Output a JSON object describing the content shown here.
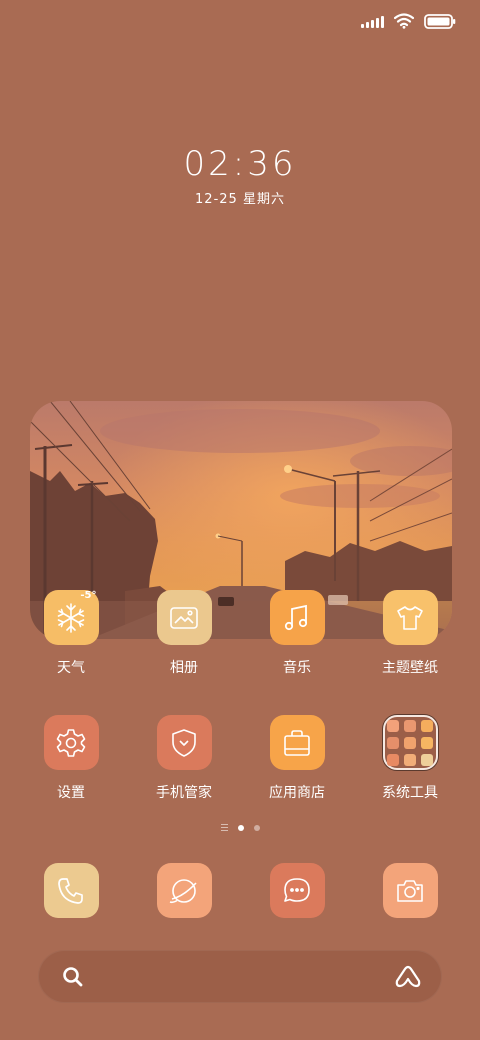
{
  "status_bar": {
    "signal_icon": "signal-bars-icon",
    "wifi_icon": "wifi-icon",
    "battery_icon": "battery-icon"
  },
  "clock": {
    "time": "02:36",
    "date": "12-25 星期六"
  },
  "photo_widget": {
    "icon": "sunset-photo"
  },
  "apps_row1": [
    {
      "label": "天气",
      "icon": "snowflake-icon",
      "badge": "-5°",
      "color": "#f6bd66"
    },
    {
      "label": "相册",
      "icon": "gallery-icon",
      "color": "#ebc88e"
    },
    {
      "label": "音乐",
      "icon": "music-note-icon",
      "color": "#f6a349"
    },
    {
      "label": "主题壁纸",
      "icon": "tshirt-icon",
      "color": "#f8c16b"
    }
  ],
  "apps_row2": [
    {
      "label": "设置",
      "icon": "gear-icon",
      "color": "#db7a5c"
    },
    {
      "label": "手机管家",
      "icon": "shield-icon",
      "color": "#da7a5c"
    },
    {
      "label": "应用商店",
      "icon": "shopping-bag-icon",
      "color": "#f7a449"
    },
    {
      "label": "系统工具",
      "icon": "folder-icon",
      "color": "#9b5e48"
    }
  ],
  "folder_icons": [
    "#f2a17a",
    "#e99770",
    "#f5ad5d",
    "#e58f6a",
    "#f0a26d",
    "#f6b562",
    "#e88a63",
    "#f2ad78",
    "#eecf9a"
  ],
  "page_indicator": {
    "current": 2,
    "total": 3
  },
  "dock": [
    {
      "icon": "phone-icon",
      "color": "#ecca90"
    },
    {
      "icon": "browser-icon",
      "color": "#f3a47a"
    },
    {
      "icon": "messages-icon",
      "color": "#db7a5c"
    },
    {
      "icon": "camera-icon",
      "color": "#f3a47a"
    }
  ],
  "search_bar": {
    "search_icon": "search-icon",
    "assistant_icon": "assistant-icon"
  }
}
